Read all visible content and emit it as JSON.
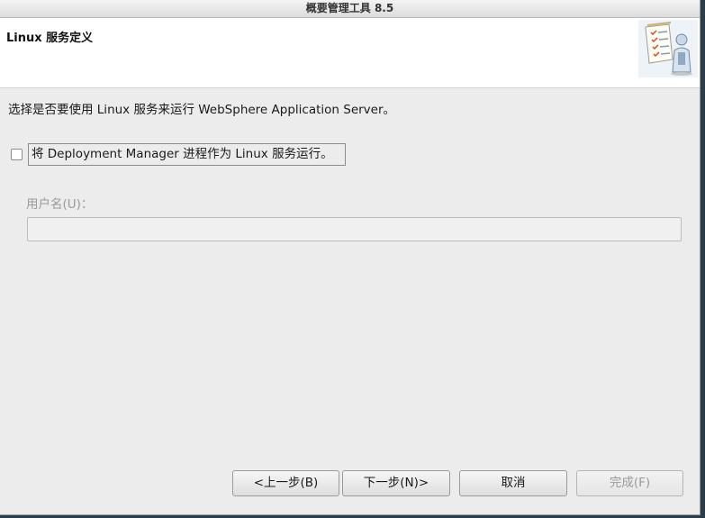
{
  "window": {
    "title": "概要管理工具 8.5"
  },
  "header": {
    "title": "Linux 服务定义",
    "icon": "wizard-checklist-person-icon"
  },
  "main": {
    "description": "选择是否要使用 Linux 服务来运行 WebSphere Application Server。",
    "run_as_service": {
      "label": "将 Deployment Manager 进程作为 Linux 服务运行。",
      "checked": false
    },
    "username": {
      "label": "用户名(U)：",
      "value": "",
      "enabled": false
    }
  },
  "footer": {
    "back_label": "<上一步(B)",
    "next_label": "下一步(N)>",
    "cancel_label": "取消",
    "finish_label": "完成(F)"
  },
  "colors": {
    "background": "#ececec",
    "header_bg": "#ffffff",
    "disabled_text": "#9a9a9a"
  }
}
